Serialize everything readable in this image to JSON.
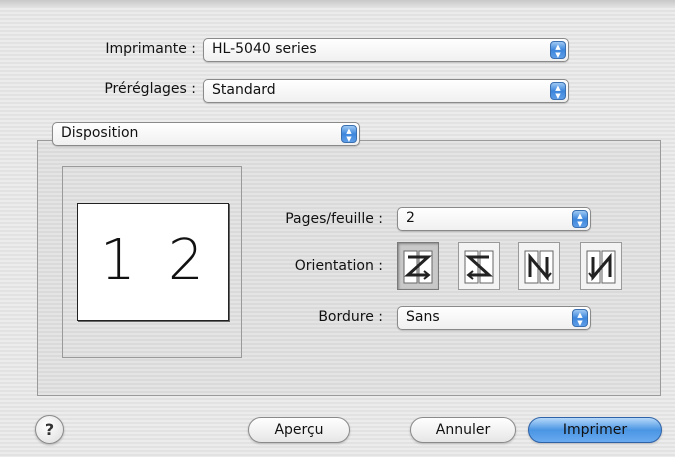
{
  "printer": {
    "label": "Imprimante :",
    "value": "HL-5040 series"
  },
  "presets": {
    "label": "Préréglages :",
    "value": "Standard"
  },
  "pane": {
    "value": "Disposition"
  },
  "preview": {
    "left_number": "1",
    "right_number": "2"
  },
  "layout": {
    "pages_label": "Pages/feuille :",
    "pages_value": "2",
    "orientation_label": "Orientation :",
    "orientation_options": [
      "Z",
      "S",
      "N-reversed",
      "N"
    ],
    "orientation_selected": 0,
    "border_label": "Bordure :",
    "border_value": "Sans"
  },
  "buttons": {
    "help": "?",
    "preview": "Aperçu",
    "cancel": "Annuler",
    "print": "Imprimer"
  },
  "colors": {
    "accent": "#4a95e3"
  }
}
